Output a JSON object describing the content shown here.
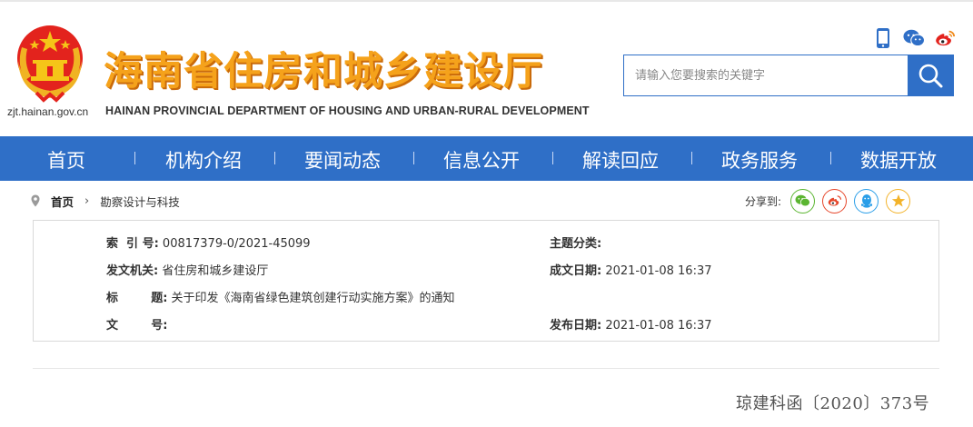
{
  "header": {
    "site_title": "海南省住房和城乡建设厅",
    "site_subtitle": "HAINAN PROVINCIAL DEPARTMENT OF HOUSING AND URBAN-RURAL DEVELOPMENT",
    "site_domain": "zjt.hainan.gov.cn",
    "icons": [
      "mobile-icon",
      "wechat-icon",
      "weibo-icon"
    ],
    "search_placeholder": "请输入您要搜索的关键字"
  },
  "nav": {
    "items": [
      "首页",
      "机构介绍",
      "要闻动态",
      "信息公开",
      "解读回应",
      "政务服务",
      "数据开放"
    ]
  },
  "breadcrumb": {
    "home": "首页",
    "current": "勘察设计与科技"
  },
  "share": {
    "label": "分享到:",
    "targets": [
      "wechat-icon",
      "weibo-icon",
      "qq-icon",
      "qzone-icon"
    ]
  },
  "info": {
    "index_label": "索  引 号:",
    "index_value": "00817379-0/2021-45099",
    "topic_label": "主题分类:",
    "topic_value": "",
    "issuer_label": "发文机关:",
    "issuer_value": "省住房和城乡建设厅",
    "created_label": "成文日期:",
    "created_value": "2021-01-08 16:37",
    "title_label": "标        题:",
    "title_value": "关于印发《海南省绿色建筑创建行动实施方案》的通知",
    "docno_label": "文        号:",
    "docno_value": "",
    "published_label": "发布日期:",
    "published_value": "2021-01-08 16:37"
  },
  "document": {
    "number": "琼建科函〔2020〕373号"
  },
  "colors": {
    "brand_blue": "#2f6fc7",
    "title_orange": "#f5a21b",
    "wechat_green": "#5bb531",
    "weibo_red": "#e6462a",
    "qq_blue": "#2a9ee8",
    "qzone_yellow": "#f3b32a"
  }
}
